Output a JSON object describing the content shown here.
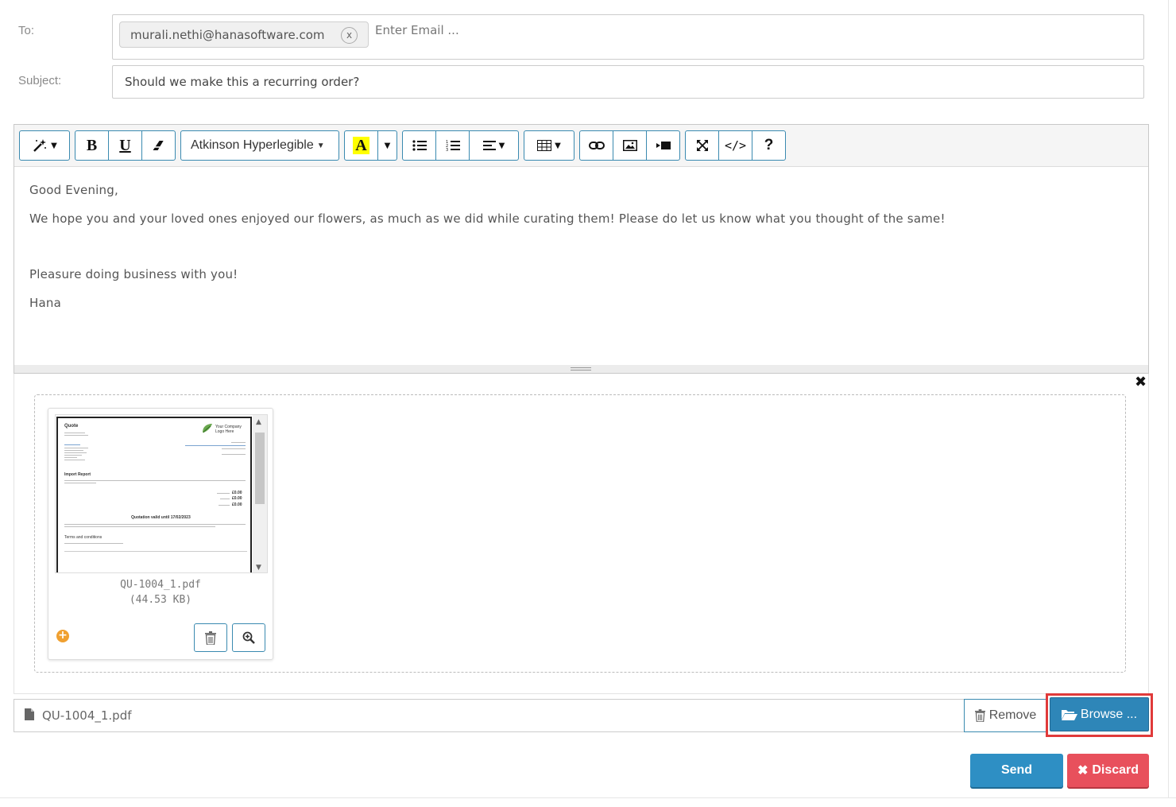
{
  "form": {
    "to_label": "To:",
    "subject_label": "Subject:",
    "to_tag": "murali.nethi@hanasoftware.com",
    "to_tag_remove": "x",
    "to_placeholder": "Enter Email ...",
    "subject_value": "Should we make this a recurring order?"
  },
  "toolbar": {
    "font_name": "Atkinson Hyperlegible",
    "bold": "B",
    "underline": "U",
    "text_color": "A",
    "help": "?",
    "code": "</>",
    "icons": [
      "magic-wand-icon",
      "eraser-icon",
      "unordered-list-icon",
      "ordered-list-icon",
      "align-icon",
      "table-icon",
      "link-icon",
      "picture-icon",
      "video-icon",
      "fullscreen-icon",
      "code-view-icon",
      "help-icon"
    ],
    "highlight_color": "#ffff00"
  },
  "body": {
    "greeting": "Good Evening,",
    "paragraph": "We hope you and your loved ones enjoyed our flowers, as much as we did while curating them! Please do let us know what you thought of the same!",
    "closing": "Pleasure doing business with you!",
    "signature": "Hana"
  },
  "attachment": {
    "file_name": "QU-1004_1.pdf",
    "file_size": "(44.53 KB)",
    "preview": {
      "title": "Quote",
      "company": "Your Company Logo Here",
      "section": "Import Report",
      "validity": "Quotation valid until 17/02/2023",
      "terms": "Terms and conditions",
      "amounts": [
        "£0.00",
        "£0.00",
        "£0.00"
      ]
    }
  },
  "file_input": {
    "file_name": "QU-1004_1.pdf",
    "remove_label": "Remove",
    "browse_label": "Browse ..."
  },
  "actions": {
    "send_label": "Send",
    "discard_label": "Discard"
  },
  "colors": {
    "primary": "#2e86b8",
    "danger": "#e8505c",
    "highlight_outline": "#e03a3a"
  }
}
